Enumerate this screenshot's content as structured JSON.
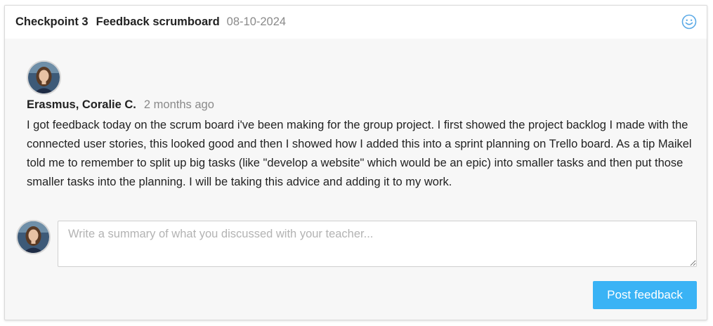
{
  "header": {
    "checkpoint_label": "Checkpoint 3",
    "title": "Feedback scrumboard",
    "date": "08-10-2024",
    "icon": "smiley-icon"
  },
  "post": {
    "author": "Erasmus, Coralie C.",
    "time_ago": "2 months ago",
    "body": "I got feedback today on the scrum board i've been making for the group project. I first showed the project backlog I made with the connected user stories, this looked good and then I showed how I added this into a sprint planning on Trello board. As a tip Maikel told me to remember to split up big tasks (like \"develop a website\" which would be an epic) into smaller tasks and then put those smaller tasks into the planning. I will be taking this advice and adding it to my work."
  },
  "reply": {
    "placeholder": "Write a summary of what you discussed with your teacher...",
    "value": "",
    "submit_label": "Post feedback"
  },
  "colors": {
    "accent": "#3ab3f5",
    "icon": "#5aa9e6",
    "muted_text": "#8a8a8a"
  }
}
